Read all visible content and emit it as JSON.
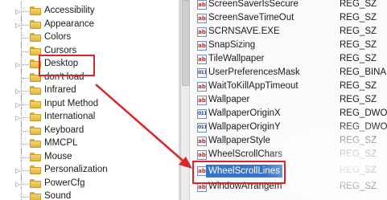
{
  "tree": {
    "items": [
      {
        "label": "Accessibility"
      },
      {
        "label": "Appearance"
      },
      {
        "label": "Colors"
      },
      {
        "label": "Cursors"
      },
      {
        "label": "Desktop"
      },
      {
        "label": "don't load"
      },
      {
        "label": "Infrared"
      },
      {
        "label": "Input Method"
      },
      {
        "label": "International"
      },
      {
        "label": "Keyboard"
      },
      {
        "label": "MMCPL"
      },
      {
        "label": "Mouse"
      },
      {
        "label": "Personalization"
      },
      {
        "label": "PowerCfg"
      },
      {
        "label": "Sound"
      }
    ]
  },
  "values": {
    "items": [
      {
        "name": "ScreenSaverIsSecure",
        "type": "REG_SZ"
      },
      {
        "name": "ScreenSaveTimeOut",
        "type": "REG_SZ"
      },
      {
        "name": "SCRNSAVE.EXE",
        "type": "REG_SZ"
      },
      {
        "name": "SnapSizing",
        "type": "REG_SZ"
      },
      {
        "name": "TileWallpaper",
        "type": "REG_SZ"
      },
      {
        "name": "UserPreferencesMask",
        "type": "REG_BINA"
      },
      {
        "name": "WaitToKillAppTimeout",
        "type": "REG_SZ"
      },
      {
        "name": "Wallpaper",
        "type": "REG_SZ"
      },
      {
        "name": "WallpaperOriginX",
        "type": "REG_DWO"
      },
      {
        "name": "WallpaperOriginY",
        "type": "REG_DWO"
      },
      {
        "name": "WallpaperStyle",
        "type": "REG_SZ"
      },
      {
        "name": "WheelScrollChars",
        "type": "REG_SZ"
      },
      {
        "name": "WheelScrollLines",
        "type": "REG_SZ"
      },
      {
        "name": "WindowArrangem",
        "type": "REG_SZ"
      }
    ]
  },
  "colors": {
    "highlight": "#d8262b",
    "selection": "#3a74c9",
    "folder": "#f0c659"
  }
}
